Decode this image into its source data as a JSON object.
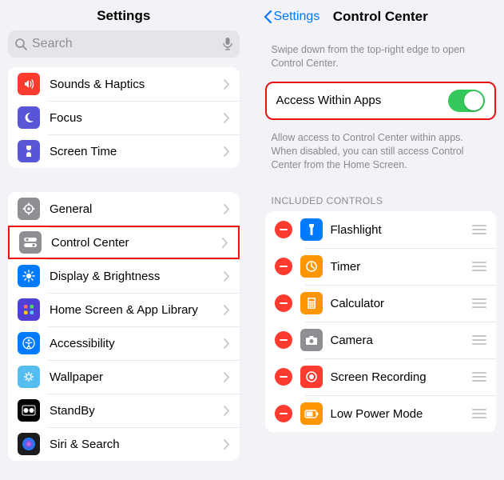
{
  "left": {
    "title": "Settings",
    "search_placeholder": "Search",
    "group1": [
      {
        "label": "Sounds & Haptics"
      },
      {
        "label": "Focus"
      },
      {
        "label": "Screen Time"
      }
    ],
    "group2": [
      {
        "label": "General"
      },
      {
        "label": "Control Center"
      },
      {
        "label": "Display & Brightness"
      },
      {
        "label": "Home Screen & App Library"
      },
      {
        "label": "Accessibility"
      },
      {
        "label": "Wallpaper"
      },
      {
        "label": "StandBy"
      },
      {
        "label": "Siri & Search"
      }
    ]
  },
  "right": {
    "back_label": "Settings",
    "title": "Control Center",
    "intro": "Swipe down from the top-right edge to open Control Center.",
    "access_label": "Access Within Apps",
    "access_help": "Allow access to Control Center within apps. When disabled, you can still access Control Center from the Home Screen.",
    "included_title": "INCLUDED CONTROLS",
    "controls": [
      {
        "label": "Flashlight"
      },
      {
        "label": "Timer"
      },
      {
        "label": "Calculator"
      },
      {
        "label": "Camera"
      },
      {
        "label": "Screen Recording"
      },
      {
        "label": "Low Power Mode"
      }
    ]
  }
}
